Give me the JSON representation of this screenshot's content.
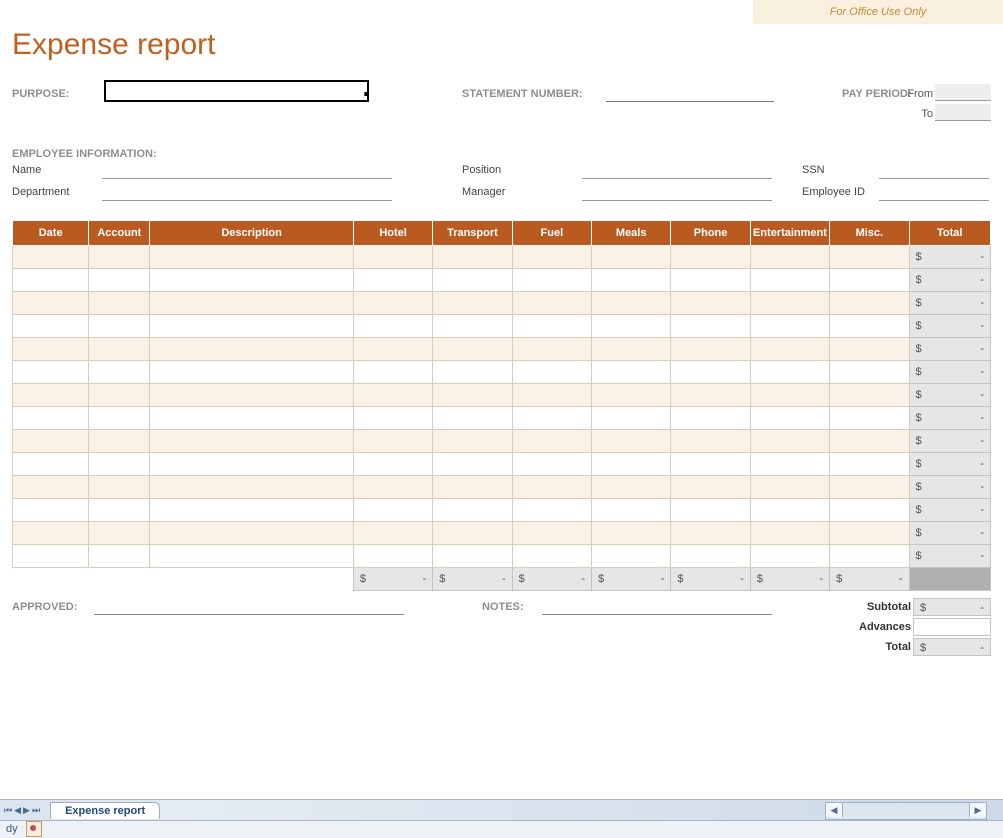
{
  "watermark": "For Office Use Only",
  "title": "Expense report",
  "labels": {
    "purpose": "PURPOSE:",
    "statement_number": "STATEMENT NUMBER:",
    "pay_period": "PAY PERIOD:",
    "from": "From",
    "to": "To",
    "employee_info": "EMPLOYEE INFORMATION:",
    "name": "Name",
    "department": "Department",
    "position": "Position",
    "manager": "Manager",
    "ssn": "SSN",
    "employee_id": "Employee ID",
    "approved": "APPROVED:",
    "notes": "NOTES:",
    "subtotal": "Subtotal",
    "advances": "Advances",
    "total": "Total"
  },
  "columns": [
    "Date",
    "Account",
    "Description",
    "Hotel",
    "Transport",
    "Fuel",
    "Meals",
    "Phone",
    "Entertainment",
    "Misc.",
    "Total"
  ],
  "currency": "$",
  "placeholder": "-",
  "row_count": 14,
  "footer_totals": {
    "hotel": "-",
    "transport": "-",
    "fuel": "-",
    "meals": "-",
    "phone": "-",
    "entertainment": "-",
    "misc": "-"
  },
  "summary": {
    "subtotal": "-",
    "advances": "",
    "total": "-"
  },
  "chrome": {
    "tab": "Expense report",
    "status": "dy"
  }
}
